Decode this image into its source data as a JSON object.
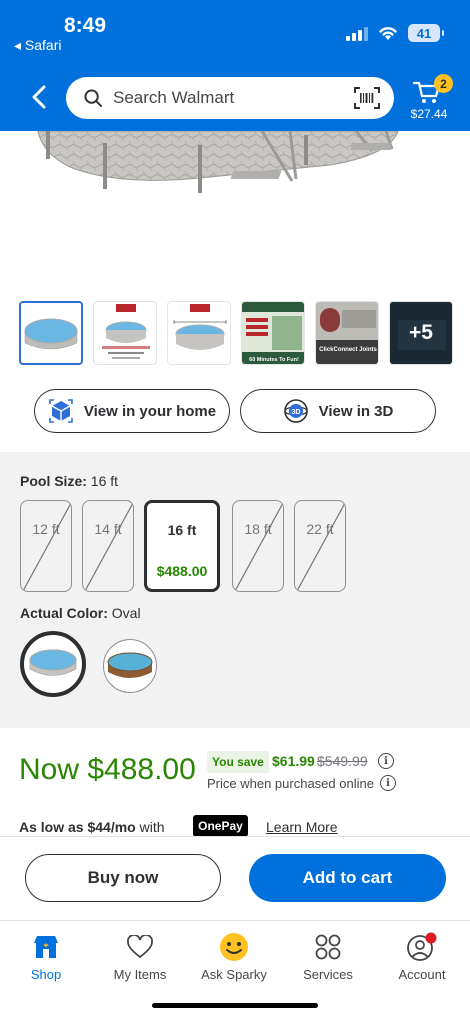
{
  "status_bar": {
    "time": "8:49",
    "back_app": "Safari",
    "battery": "41"
  },
  "header": {
    "back_icon": "chevron-left-icon",
    "search_placeholder": "Search Walmart",
    "search_icon": "search-icon",
    "barcode_icon": "barcode-scan-icon",
    "cart_icon": "cart-icon",
    "cart_count": "2",
    "cart_total": "$27.44"
  },
  "gallery": {
    "thumbnails": [
      {
        "kind": "pool-photo"
      },
      {
        "kind": "spec-sheet"
      },
      {
        "kind": "dimensions"
      },
      {
        "kind": "easy-setup",
        "caption": "60 Minutes To Fun!"
      },
      {
        "kind": "clickconnect",
        "caption": "ClickConnect Joints"
      },
      {
        "kind": "more",
        "more_label": "+5"
      }
    ]
  },
  "view_buttons": {
    "home": {
      "label": "View in your home",
      "icon": "ar-cube-icon"
    },
    "three_d": {
      "label": "View in 3D",
      "icon": "3d-icon"
    }
  },
  "pool_size": {
    "label": "Pool Size:",
    "selected": "16 ft",
    "options": [
      {
        "label": "12 ft",
        "available": false
      },
      {
        "label": "14 ft",
        "available": false
      },
      {
        "label": "16 ft",
        "available": true,
        "price": "$488.00"
      },
      {
        "label": "18 ft",
        "available": false
      },
      {
        "label": "22 ft",
        "available": false
      }
    ]
  },
  "color": {
    "label": "Actual Color:",
    "selected": "Oval",
    "swatches": [
      {
        "name": "oval-gray-pool"
      },
      {
        "name": "round-wood-pool"
      }
    ]
  },
  "price": {
    "now": "Now $488.00",
    "you_save_label": "You save",
    "save_amount": "$61.99",
    "was": "$549.99",
    "note": "Price when purchased online",
    "as_low_prefix": "As low as $44/mo",
    "as_low_suffix": "with",
    "onepay": "OnePay",
    "learn_more": "Learn More"
  },
  "actions": {
    "buy_now": "Buy now",
    "add_to_cart": "Add to cart"
  },
  "bottom_nav": [
    {
      "label": "Shop",
      "icon": "shop-icon",
      "active": true
    },
    {
      "label": "My Items",
      "icon": "heart-icon",
      "active": false
    },
    {
      "label": "Ask Sparky",
      "icon": "sparky-icon",
      "active": false
    },
    {
      "label": "Services",
      "icon": "services-grid-icon",
      "active": false
    },
    {
      "label": "Account",
      "icon": "account-icon",
      "active": false
    }
  ],
  "colors": {
    "brand_blue": "#0071dc",
    "price_green": "#2a8703",
    "spark_yellow": "#ffc220"
  }
}
